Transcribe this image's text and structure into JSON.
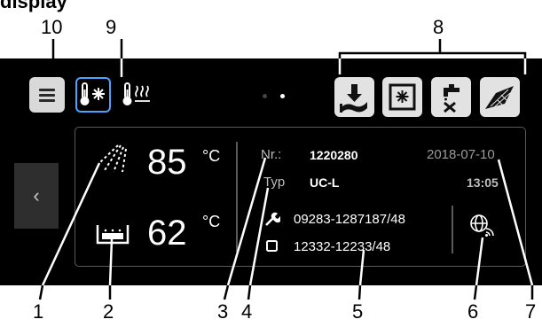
{
  "page": {
    "title": "display"
  },
  "callouts": [
    "10",
    "9",
    "8",
    "1",
    "2",
    "3",
    "4",
    "5",
    "6",
    "7"
  ],
  "temperatures": {
    "spray": {
      "value": "85",
      "unit": "°C"
    },
    "tank": {
      "value": "62",
      "unit": "°C"
    }
  },
  "info": {
    "nr_label": "Nr.:",
    "nr_value": "1220280",
    "typ_label": "Typ",
    "typ_value": "UC-L",
    "date": "2018-07-10",
    "time": "13:05",
    "service_code": "09283-1287187/48",
    "device_code": "12332-12233/48"
  },
  "nav": {
    "back_arrow": "‹"
  },
  "icons": {
    "menu": "menu-icon",
    "mode_active": "thermometer-snowflake-icon",
    "mode_inactive": "thermometer-heat-icon",
    "tiles": [
      "drain-icon",
      "door-program-icon",
      "tap-cancel-icon",
      "cleaning-surface-icon"
    ],
    "spray": "spray-icon",
    "tank": "tank-icon",
    "network": "network-globe-icon"
  },
  "colors": {
    "screen_bg": "#000000",
    "accent": "#4aa3ff",
    "tile_bg": "#e2e2e2"
  }
}
